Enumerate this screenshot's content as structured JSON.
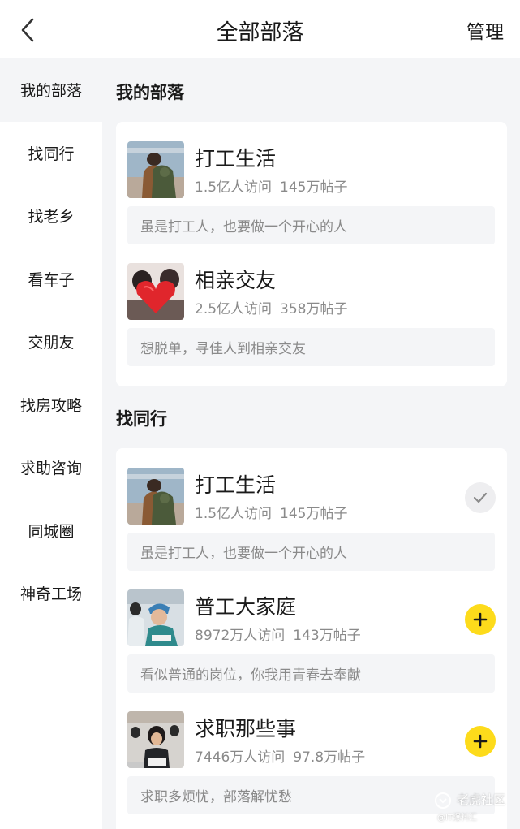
{
  "header": {
    "title": "全部部落",
    "manage_label": "管理"
  },
  "sidebar": {
    "items": [
      {
        "label": "我的部落",
        "active": true
      },
      {
        "label": "找同行"
      },
      {
        "label": "找老乡"
      },
      {
        "label": "看车子"
      },
      {
        "label": "交朋友"
      },
      {
        "label": "找房攻略"
      },
      {
        "label": "求助咨询"
      },
      {
        "label": "同城圈"
      },
      {
        "label": "神奇工场"
      }
    ]
  },
  "sections": [
    {
      "title": "我的部落",
      "tribes": [
        {
          "name": "打工生活",
          "visits": "1.5亿人访问",
          "posts": "145万帖子",
          "desc": "虽是打工人，也要做一个开心的人"
        },
        {
          "name": "相亲交友",
          "visits": "2.5亿人访问",
          "posts": "358万帖子",
          "desc": "想脱单，寻佳人到相亲交友"
        }
      ]
    },
    {
      "title": "找同行",
      "tribes": [
        {
          "name": "打工生活",
          "visits": "1.5亿人访问",
          "posts": "145万帖子",
          "desc": "虽是打工人，也要做一个开心的人",
          "action": "joined"
        },
        {
          "name": "普工大家庭",
          "visits": "8972万人访问",
          "posts": "143万帖子",
          "desc": "看似普通的岗位，你我用青春去奉献",
          "action": "add"
        },
        {
          "name": "求职那些事",
          "visits": "7446万人访问",
          "posts": "97.8万帖子",
          "desc": "求职多烦忧，部落解忧愁",
          "action": "add"
        }
      ]
    }
  ],
  "watermark": {
    "name": "老虎社区",
    "sub": "@IT爆料汇"
  },
  "colors": {
    "accent": "#fddb1b",
    "background": "#f4f5f7",
    "secondary_text": "#8a8a8a"
  }
}
